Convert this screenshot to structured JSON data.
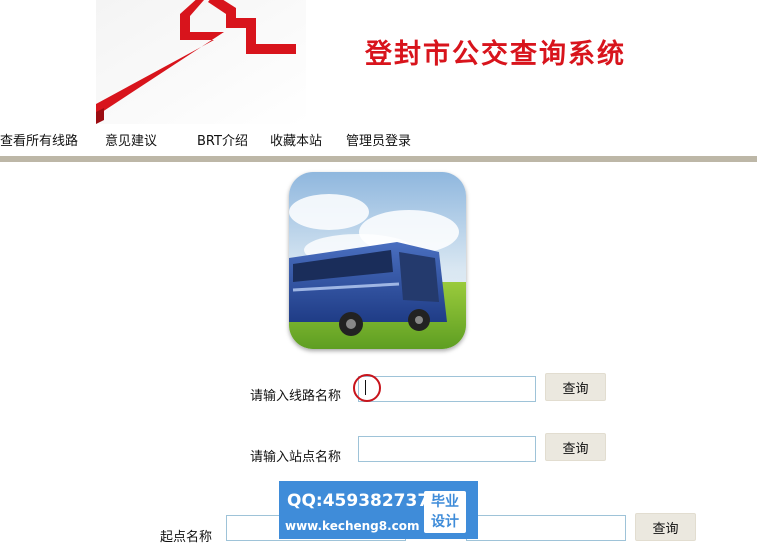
{
  "header": {
    "title": "登封市公交查询系统",
    "logo_icon": "red-house-roof-icon",
    "accent_color": "#d8141c"
  },
  "nav": {
    "items": [
      {
        "label": "查看所有线路"
      },
      {
        "label": "意见建议"
      },
      {
        "label": "BRT介绍"
      },
      {
        "label": "收藏本站"
      },
      {
        "label": "管理员登录"
      }
    ]
  },
  "hero": {
    "image_icon": "bus-icon"
  },
  "forms": {
    "route": {
      "label": "请输入线路名称",
      "value": "",
      "button": "查询"
    },
    "station": {
      "label": "请输入站点名称",
      "value": "",
      "button": "查询"
    },
    "trip": {
      "label": "起点名称",
      "start_value": "",
      "end_value": "",
      "button": "查询"
    }
  },
  "watermark": {
    "qq": "QQ:459382737",
    "url": "www.kecheng8.com",
    "badge_line1": "毕业",
    "badge_line2": "设计"
  }
}
